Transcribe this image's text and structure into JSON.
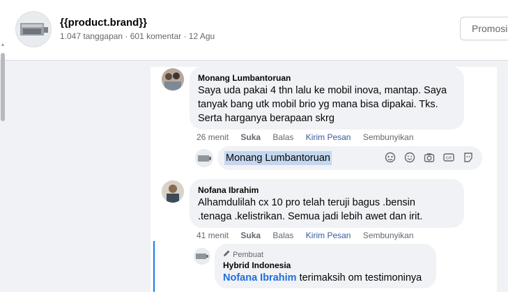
{
  "header": {
    "brand": "{{product.brand}}",
    "meta": "1.047 tanggapan · 601 komentar · 12 Agu",
    "promo_button": "Promosi"
  },
  "comments": [
    {
      "author": "Monang Lumbantoruan",
      "lines": [
        "Saya uda pakai 4 thn lalu ke mobil inova, mantap. Saya",
        "tanyak bang utk mobil brio yg mana bisa dipakai. Tks.",
        "Serta harganya berapaan skrg"
      ],
      "time": "26 menit",
      "like": "Suka",
      "reply": "Balas",
      "message": "Kirim Pesan",
      "hide": "Sembunyikan"
    },
    {
      "author": "Nofana Ibrahim",
      "lines": [
        "Alhamdulilah cx 10 pro telah teruji bagus .bensin",
        ".tenaga .kelistrikan. Semua jadi lebih awet dan irit."
      ],
      "time": "41 menit",
      "like": "Suka",
      "reply": "Balas",
      "message": "Kirim Pesan",
      "hide": "Sembunyikan"
    }
  ],
  "reply_box": {
    "value": "Monang Lumbantoruan",
    "icons": [
      "sticker-icon",
      "emoji-icon",
      "camera-icon",
      "gif-icon",
      "avatar-sticker-icon"
    ]
  },
  "page_reply": {
    "badge": "Pembuat",
    "author": "Hybrid Indonesia",
    "mention": "Nofana Ibrahim",
    "text": "terimaksih om testimoninya"
  },
  "colors": {
    "link_blue": "#385898",
    "mention_blue": "#216fdb",
    "thread_line": "#1877f2",
    "bubble": "#f0f2f5",
    "selection": "#c4d7ef"
  }
}
